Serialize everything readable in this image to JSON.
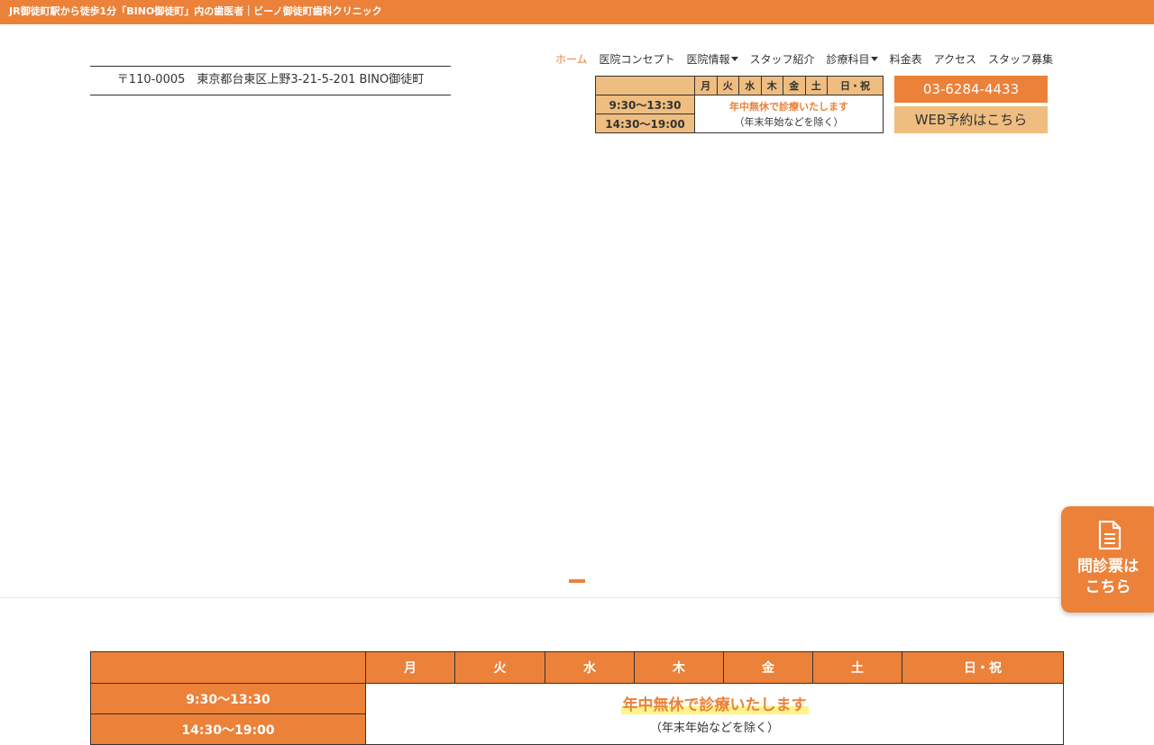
{
  "topbar": {
    "text": "JR御徒町駅から徒歩1分「BINO御徒町」内の歯医者｜ビーノ御徒町歯科クリニック"
  },
  "header": {
    "address": "〒110-0005　東京都台東区上野3-21-5-201 BINO御徒町"
  },
  "nav": {
    "items": [
      {
        "label": "ホーム",
        "active": true
      },
      {
        "label": "医院コンセプト"
      },
      {
        "label": "医院情報",
        "dropdown": true
      },
      {
        "label": "スタッフ紹介"
      },
      {
        "label": "診療科目",
        "dropdown": true
      },
      {
        "label": "料金表"
      },
      {
        "label": "アクセス"
      },
      {
        "label": "スタッフ募集"
      }
    ]
  },
  "schedule": {
    "days": [
      "月",
      "火",
      "水",
      "木",
      "金",
      "土",
      "日・祝"
    ],
    "times": [
      "9:30〜13:30",
      "14:30〜19:00"
    ],
    "open_all_year": "年中無休で診療いたします",
    "exception": "（年末年始などを除く）"
  },
  "buttons": {
    "phone": "03-6284-4433",
    "web": "WEB予約はこちら"
  },
  "side_tab": {
    "label_line1": "問診票は",
    "label_line2": "こちら",
    "icon": "document-icon"
  },
  "colors": {
    "accent": "#ec8139",
    "accent_light": "#eebd7f",
    "highlight": "#fff389"
  }
}
